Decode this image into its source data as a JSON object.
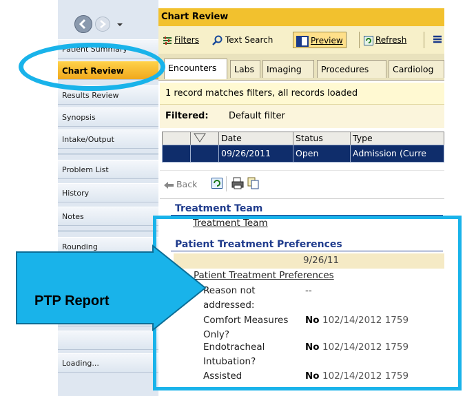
{
  "sidebar": {
    "items": [
      {
        "label": "Patient Summary"
      },
      {
        "label": "Chart Review"
      },
      {
        "label": "Results Review"
      },
      {
        "label": "Synopsis"
      },
      {
        "label": "Intake/Output"
      },
      {
        "label": "Problem List"
      },
      {
        "label": "History"
      },
      {
        "label": "Notes"
      },
      {
        "label": "Rounding"
      },
      {
        "label": "Loading..."
      }
    ]
  },
  "activity": {
    "title": "Chart Review"
  },
  "toolbar": {
    "filters_label": "Filters",
    "text_search_label": "Text Search",
    "preview_label": "Preview",
    "refresh_label": "Refresh"
  },
  "tabs": [
    {
      "label": "Encounters"
    },
    {
      "label": "Labs"
    },
    {
      "label": "Imaging"
    },
    {
      "label": "Procedures"
    },
    {
      "label": "Cardiolog"
    }
  ],
  "status": {
    "message": "1 record matches filters, all records loaded"
  },
  "filter": {
    "label": "Filtered:",
    "value": "Default filter"
  },
  "grid": {
    "headers": [
      "Date",
      "Status",
      "Type"
    ],
    "rows": [
      {
        "date": "09/26/2011",
        "status": "Open",
        "type": "Admission (Curre"
      }
    ]
  },
  "nav": {
    "back_label": "Back"
  },
  "report": {
    "treatment_team_heading": "Treatment Team",
    "treatment_team_link": "Treatment Team",
    "ptp_heading": "Patient Treatment Preferences",
    "date_col": "9/26/11",
    "ptp_subheading": "Patient Treatment Preferences",
    "rows": [
      {
        "label1": "Reason not",
        "label2": "addressed:",
        "value": "--",
        "detail": ""
      },
      {
        "label1": "Comfort Measures",
        "label2": "Only?",
        "value": "No",
        "detail": "102/14/2012 1759"
      },
      {
        "label1": "Endotracheal",
        "label2": "Intubation?",
        "value": "No",
        "detail": "102/14/2012 1759"
      },
      {
        "label1": "Assisted",
        "label2": "",
        "value": "No",
        "detail": "102/14/2012 1759"
      }
    ]
  },
  "callout": {
    "text": "PTP Report"
  },
  "colors": {
    "highlight": "#19b3ea",
    "accent": "#f2c12e",
    "selected_row": "#0f2d6b"
  }
}
